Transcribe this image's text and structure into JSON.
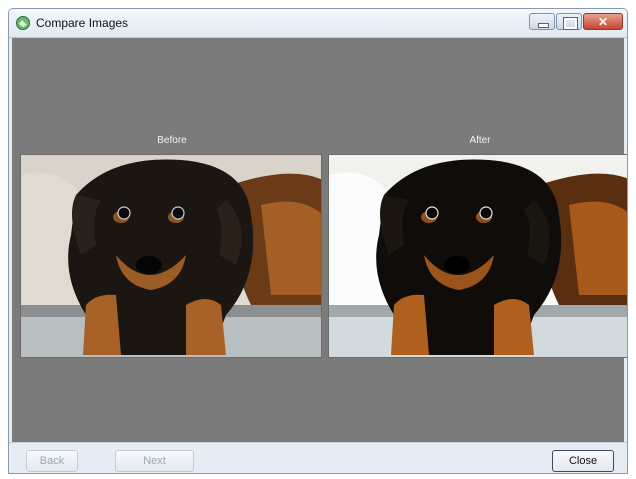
{
  "window": {
    "title": "Compare Images",
    "icon": "compare-images-app-icon"
  },
  "title_buttons": {
    "minimize_icon": "minimize-icon",
    "maximize_icon": "maximize-icon",
    "close_icon": "close-icon",
    "close_glyph": "✕"
  },
  "panels": {
    "before_label": "Before",
    "after_label": "After"
  },
  "buttons": {
    "back": "Back",
    "next": "Next",
    "close": "Close"
  },
  "colors": {
    "background": "#7b7b7b",
    "close_button": "#c7452e"
  }
}
